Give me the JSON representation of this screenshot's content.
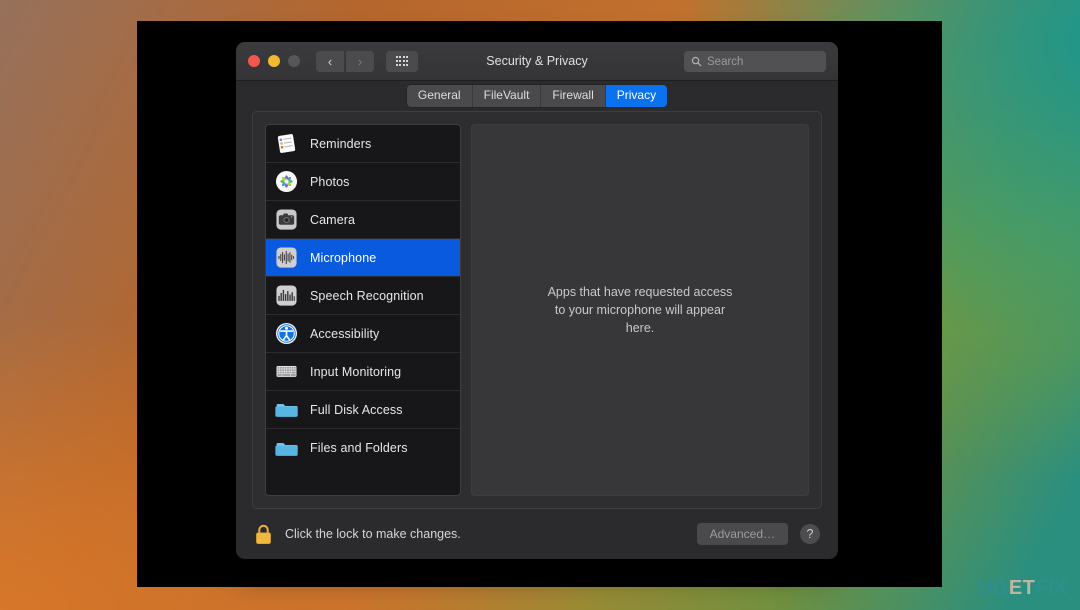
{
  "window": {
    "title": "Security & Privacy",
    "traffic_lights": [
      {
        "name": "close",
        "color": "#f2574b"
      },
      {
        "name": "minimize",
        "color": "#f3bb2c"
      },
      {
        "name": "zoom",
        "color": "#565659"
      }
    ],
    "nav": {
      "back": "‹",
      "forward": "›"
    },
    "grid_button": "show-all-icon"
  },
  "search": {
    "placeholder": "Search",
    "value": "",
    "icon": "search-icon"
  },
  "tabs": [
    {
      "label": "General",
      "active": false
    },
    {
      "label": "FileVault",
      "active": false
    },
    {
      "label": "Firewall",
      "active": false
    },
    {
      "label": "Privacy",
      "active": true
    }
  ],
  "sidebar": {
    "items": [
      {
        "label": "Reminders",
        "icon": "reminders-icon",
        "selected": false
      },
      {
        "label": "Photos",
        "icon": "photos-icon",
        "selected": false
      },
      {
        "label": "Camera",
        "icon": "camera-icon",
        "selected": false
      },
      {
        "label": "Microphone",
        "icon": "microphone-icon",
        "selected": true
      },
      {
        "label": "Speech Recognition",
        "icon": "speech-recognition-icon",
        "selected": false
      },
      {
        "label": "Accessibility",
        "icon": "accessibility-icon",
        "selected": false
      },
      {
        "label": "Input Monitoring",
        "icon": "keyboard-icon",
        "selected": false
      },
      {
        "label": "Full Disk Access",
        "icon": "folder-icon",
        "selected": false
      },
      {
        "label": "Files and Folders",
        "icon": "folder-icon",
        "selected": false
      }
    ]
  },
  "detail": {
    "empty_message": "Apps that have requested access to your microphone will appear here."
  },
  "footer": {
    "lock_icon": "lock-closed-icon",
    "lock_text": "Click the lock to make changes.",
    "advanced_label": "Advanced…",
    "help_label": "?"
  },
  "watermark": {
    "part1": "UG",
    "part2": "ET",
    "part3": "FIX"
  },
  "colors": {
    "accent_blue": "#0a72ef",
    "selection_blue": "#0a5ae0",
    "window_bg": "#2b2b2d",
    "sidebar_bg": "#17171a",
    "detail_bg": "#37373a"
  }
}
